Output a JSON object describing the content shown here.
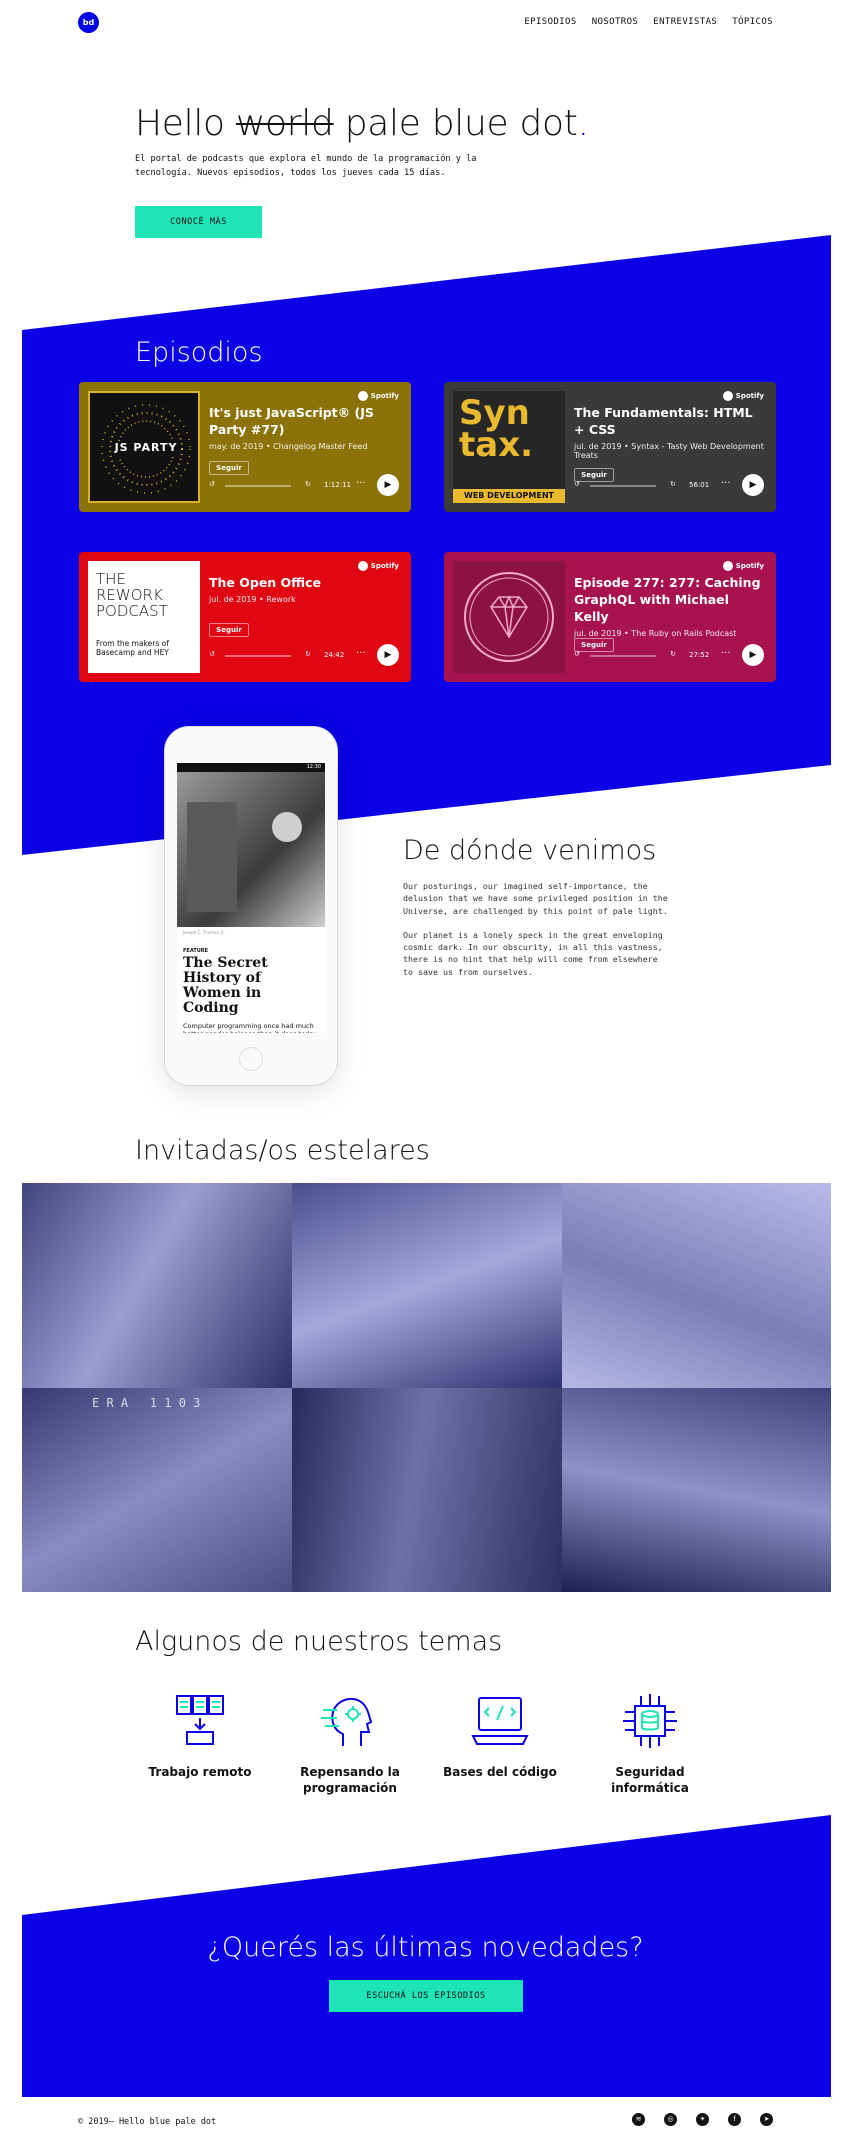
{
  "nav": {
    "logo": "bd",
    "links": [
      "EPISODIOS",
      "NOSOTROS",
      "ENTREVISTAS",
      "TÓPICOS"
    ]
  },
  "hero": {
    "title_pre": "Hello",
    "title_strike": "world",
    "title_post": "pale blue dot",
    "title_dot": ".",
    "lead": "El portal de podcasts que explora el mundo de la programación y la tecnología. Nuevos episodios, todos los jueves cada 15 días.",
    "cta": "CONOCÉ MÁS"
  },
  "episodes": {
    "title": "Episodios",
    "spotify_label": "Spotify",
    "follow_label": "Seguir",
    "items": [
      {
        "title": "It's just JavaScript® (JS Party #77)",
        "meta": "may. de 2019 • Changelog Master Feed",
        "time": "1:12:11",
        "bg": "#8c7309",
        "art_text": "JS PARTY"
      },
      {
        "title": "The Fundamentals: HTML + CSS",
        "meta": "jul. de 2019 • Syntax - Tasty Web Development Treats",
        "time": "56:01",
        "bg": "#3a3a3a",
        "art_text": "Syn tax.",
        "art_sub": "WEB DEVELOPMENT"
      },
      {
        "title": "The Open Office",
        "meta": "jul. de 2019 • Rework",
        "time": "24:42",
        "bg": "#e00712",
        "art_text": "THE REWORK PODCAST",
        "art_sub": "From the makers of Basecamp and HEY"
      },
      {
        "title": "Episode 277: 277: Caching GraphQL with Michael Kelly",
        "meta": "jul. de 2019 • The Ruby on Rails Podcast",
        "time": "27:52",
        "bg": "#a8124e",
        "art_text": ""
      }
    ]
  },
  "origin": {
    "title": "De dónde venimos",
    "p1": "Our posturings, our imagined self-importance, the delusion that we have some privileged position in the Universe, are challenged by this point of pale light.",
    "p2": "Our planet is a lonely speck in the great enveloping cosmic dark. In our obscurity, in all this vastness, there is no hint that help will come from elsewhere to save us from ourselves.",
    "phone": {
      "time": "12:30",
      "caption": "Joseph C. Thomas, Jr.",
      "feature": "FEATURE",
      "headline": "The Secret History of Women in Coding",
      "desc": "Computer programming once had much better gender balance than it does today. What went wrong?"
    }
  },
  "guests": {
    "title": "Invitadas/os estelares",
    "photo_label": "E R A   1 1 0 3"
  },
  "topics": {
    "title": "Algunos de nuestros temas",
    "items": [
      {
        "label": "Trabajo remoto",
        "icon": "remote-work-icon"
      },
      {
        "label": "Repensando la programación",
        "icon": "rethinking-programming-icon"
      },
      {
        "label": "Bases del código",
        "icon": "codebase-icon"
      },
      {
        "label": "Seguridad informática",
        "icon": "security-icon"
      }
    ]
  },
  "newsletter": {
    "title": "¿Querés las últimas novedades?",
    "cta": "ESCUCHÁ LOS EPISODIOS"
  },
  "footer": {
    "copyright": "© 2019— Hello blue pale dot"
  },
  "colors": {
    "accent": "#0b00e6",
    "cta": "#1fe5b6"
  }
}
